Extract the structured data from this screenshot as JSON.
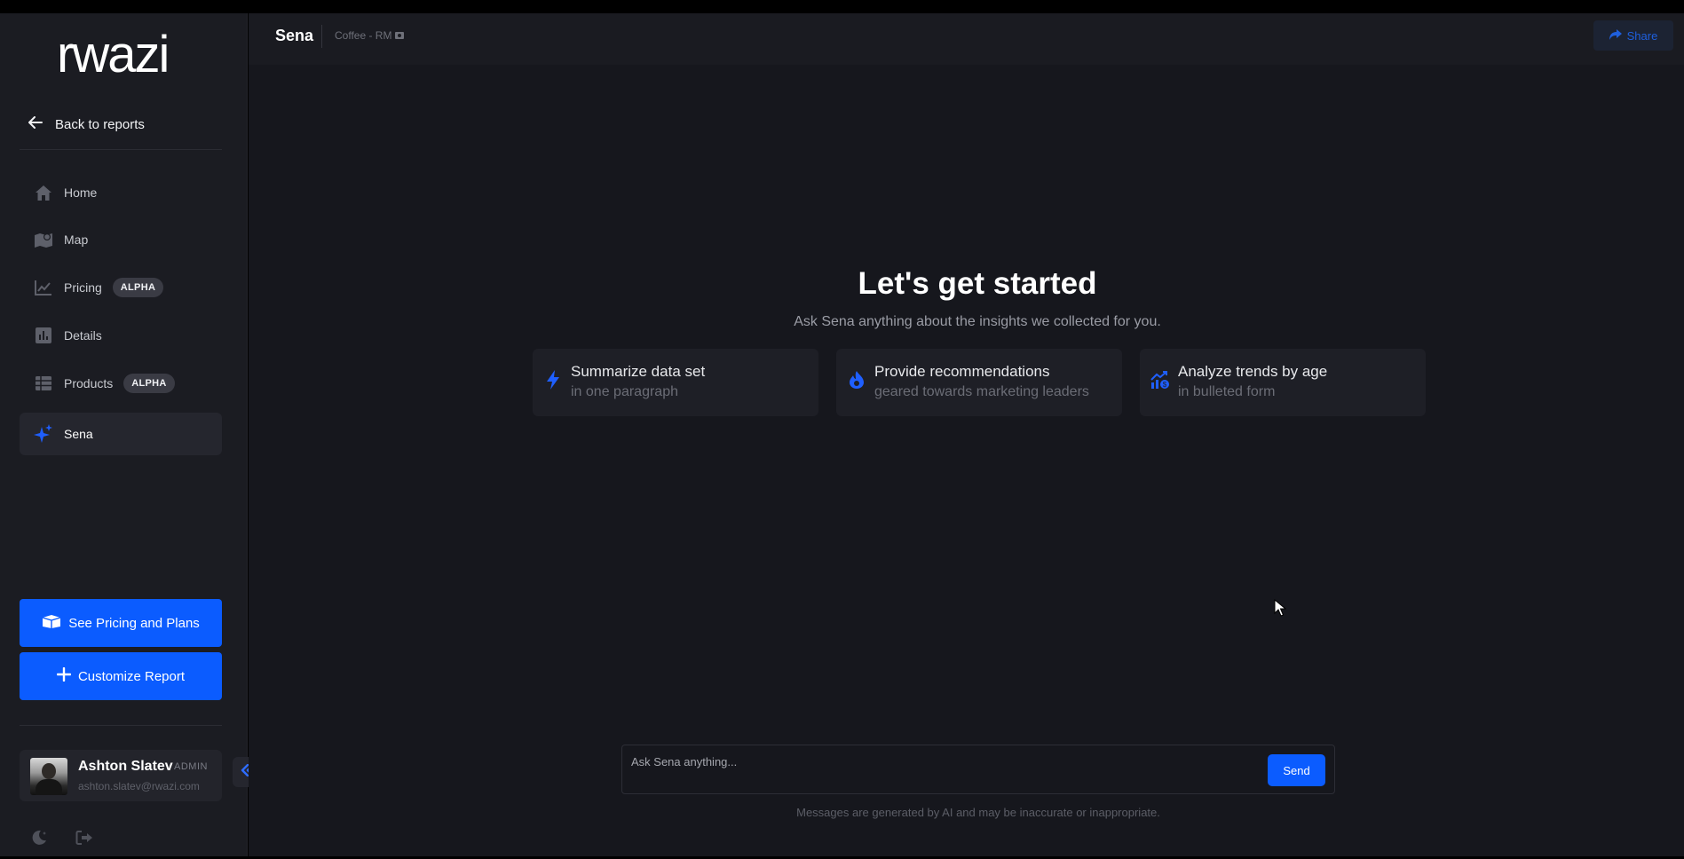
{
  "app": {
    "logo_text": "rwazi"
  },
  "sidebar": {
    "back_label": "Back to reports",
    "items": [
      {
        "label": "Home",
        "icon": "home-icon",
        "badge": ""
      },
      {
        "label": "Map",
        "icon": "map-icon",
        "badge": ""
      },
      {
        "label": "Pricing",
        "icon": "chart-line-icon",
        "badge": "ALPHA"
      },
      {
        "label": "Details",
        "icon": "bar-chart-icon",
        "badge": ""
      },
      {
        "label": "Products",
        "icon": "table-icon",
        "badge": "ALPHA"
      },
      {
        "label": "Sena",
        "icon": "sparkles-icon",
        "badge": ""
      }
    ],
    "active_item": "Sena",
    "pricing_plans_label": "See Pricing and Plans",
    "customize_label": "Customize Report",
    "user": {
      "name": "Ashton Slatev",
      "role": "ADMIN",
      "email": "ashton.slatev@rwazi.com"
    }
  },
  "header": {
    "title": "Sena",
    "subtitle": "Coffee - RM",
    "share_label": "Share"
  },
  "main": {
    "heading": "Let's get started",
    "subheading": "Ask Sena anything about the insights we collected for you.",
    "suggestions": [
      {
        "title": "Summarize data set",
        "detail": "in one paragraph",
        "icon": "bolt-icon"
      },
      {
        "title": "Provide recommendations",
        "detail": "geared towards marketing leaders",
        "icon": "fire-icon"
      },
      {
        "title": "Analyze trends by age",
        "detail": "in bulleted form",
        "icon": "trend-icon"
      }
    ],
    "chat": {
      "placeholder": "Ask Sena anything...",
      "send_label": "Send",
      "disclaimer": "Messages are generated by AI and may be inaccurate or inappropriate."
    }
  },
  "colors": {
    "accent": "#0b5cff",
    "sidebar_bg": "#1b1c22",
    "main_bg": "#16171d"
  }
}
